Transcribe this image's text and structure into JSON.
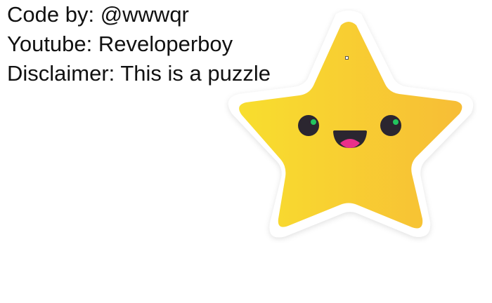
{
  "credits": {
    "line1": "Code by: @wwwqr",
    "line2": "Youtube: Reveloperboy",
    "line3": "Disclaimer: This is a puzzle"
  },
  "star": {
    "icon": "smiling-star-icon",
    "colors": {
      "outline": "#ffffff",
      "fill_left": "#f8de2e",
      "fill_right": "#f7bd36",
      "eye": "#2b2630",
      "pupil": "#22c55e",
      "mouth": "#2b2630",
      "tongue": "#ea2f8a"
    }
  }
}
